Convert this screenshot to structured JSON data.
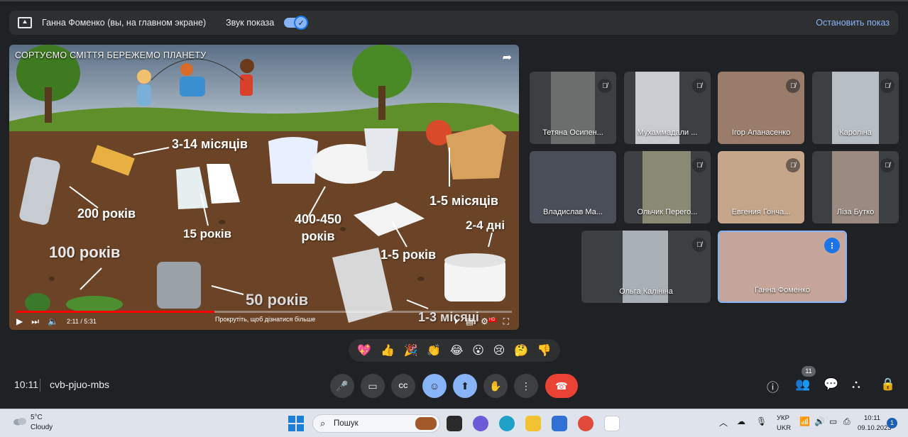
{
  "presentation_bar": {
    "presenter": "Ганна Фоменко (вы, на главном экране)",
    "sound_label": "Звук показа",
    "sound_check": "✓",
    "stop_label": "Остановить показ"
  },
  "video": {
    "title": "СОРТУЄМО СМІТТЯ БЕРЕЖЕМО ПЛАНЕТУ",
    "labels": [
      "3-14 місяців",
      "200 років",
      "15 років",
      "400-450 років",
      "1-5 місяців",
      "2-4 дні",
      "100 років",
      "1-5 років",
      "50 років",
      "1-3 місяці"
    ],
    "progress_fraction": 0.4,
    "time_display": "2:11 / 5:31",
    "scroll_hint": "Прокрутіть, щоб дізнатися більше",
    "hd_badge": "HD"
  },
  "participants": [
    {
      "name": "Тетяна Осипен..."
    },
    {
      "name": "Мухаммадали ..."
    },
    {
      "name": "Ігор Апанасенко"
    },
    {
      "name": "Кароліна"
    },
    {
      "name": "Владислав Ма..."
    },
    {
      "name": "Ольчик Перего..."
    },
    {
      "name": "Евгения Гонча..."
    },
    {
      "name": "Ліза Бутко"
    },
    {
      "name": "Ольга Калініна"
    },
    {
      "name": "Ганна Фоменко"
    }
  ],
  "reactions": [
    "💖",
    "👍",
    "🎉",
    "👏",
    "😂",
    "😮",
    "😢",
    "🤔",
    "👎"
  ],
  "meeting": {
    "time": "10:11",
    "code": "cvb-pjuo-mbs",
    "participant_count": "11"
  },
  "taskbar": {
    "weather_temp": "5°C",
    "weather_cond": "Cloudy",
    "search_placeholder": "Пошук",
    "lang_top": "УКР",
    "lang_bottom": "UKR",
    "clock_time": "10:11",
    "clock_date": "09.10.2023",
    "notification_count": "1"
  }
}
